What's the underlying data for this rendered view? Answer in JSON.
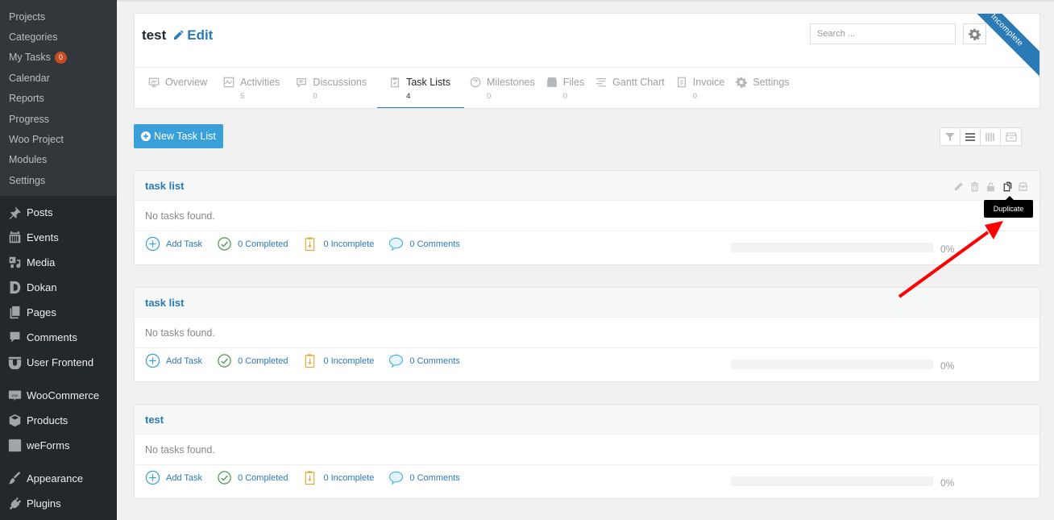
{
  "sidebar": {
    "submenu": [
      {
        "label": "Projects"
      },
      {
        "label": "Categories"
      },
      {
        "label": "My Tasks",
        "badge": "0"
      },
      {
        "label": "Calendar"
      },
      {
        "label": "Reports"
      },
      {
        "label": "Progress"
      },
      {
        "label": "Woo Project"
      },
      {
        "label": "Modules"
      },
      {
        "label": "Settings"
      }
    ],
    "menu": [
      {
        "label": "Posts",
        "icon": "pin-icon"
      },
      {
        "label": "Events",
        "icon": "calendar-icon"
      },
      {
        "label": "Media",
        "icon": "media-icon"
      },
      {
        "label": "Dokan",
        "icon": "dokan-icon"
      },
      {
        "label": "Pages",
        "icon": "pages-icon"
      },
      {
        "label": "Comments",
        "icon": "comment-icon"
      },
      {
        "label": "User Frontend",
        "icon": "user-frontend-icon"
      },
      {
        "label": "WooCommerce",
        "icon": "woocommerce-icon"
      },
      {
        "label": "Products",
        "icon": "box-icon"
      },
      {
        "label": "weForms",
        "icon": "weforms-icon"
      },
      {
        "label": "Appearance",
        "icon": "brush-icon"
      },
      {
        "label": "Plugins",
        "icon": "plug-icon"
      }
    ]
  },
  "project": {
    "title": "test",
    "edit_label": "Edit",
    "status_ribbon": "Incomplete",
    "search_placeholder": "Search ..."
  },
  "tabs": [
    {
      "label": "Overview",
      "count": ""
    },
    {
      "label": "Activities",
      "count": "5"
    },
    {
      "label": "Discussions",
      "count": "0"
    },
    {
      "label": "Task Lists",
      "count": "4",
      "active": true
    },
    {
      "label": "Milestones",
      "count": "0"
    },
    {
      "label": "Files",
      "count": "0"
    },
    {
      "label": "Gantt Chart",
      "count": ""
    },
    {
      "label": "Invoice",
      "count": "0"
    },
    {
      "label": "Settings",
      "count": ""
    }
  ],
  "toolbar": {
    "new_list_label": "New Task List"
  },
  "task_lists": [
    {
      "title": "task list",
      "empty_text": "No tasks found.",
      "add_task": "Add Task",
      "completed": "0 Completed",
      "incomplete": "0 Incomplete",
      "comments": "0 Comments",
      "progress_percent": 0,
      "progress_label": "0%"
    },
    {
      "title": "task list",
      "empty_text": "No tasks found.",
      "add_task": "Add Task",
      "completed": "0 Completed",
      "incomplete": "0 Incomplete",
      "comments": "0 Comments",
      "progress_percent": 0,
      "progress_label": "0%"
    },
    {
      "title": "test",
      "empty_text": "No tasks found.",
      "add_task": "Add Task",
      "completed": "0 Completed",
      "incomplete": "0 Incomplete",
      "comments": "0 Comments",
      "progress_percent": 0,
      "progress_label": "0%"
    }
  ],
  "tooltip": {
    "text": "Duplicate"
  },
  "colors": {
    "accent": "#2a7ab6",
    "button": "#3aa0da",
    "badge": "#ca4a1f",
    "annotation_arrow": "#ff0000"
  }
}
